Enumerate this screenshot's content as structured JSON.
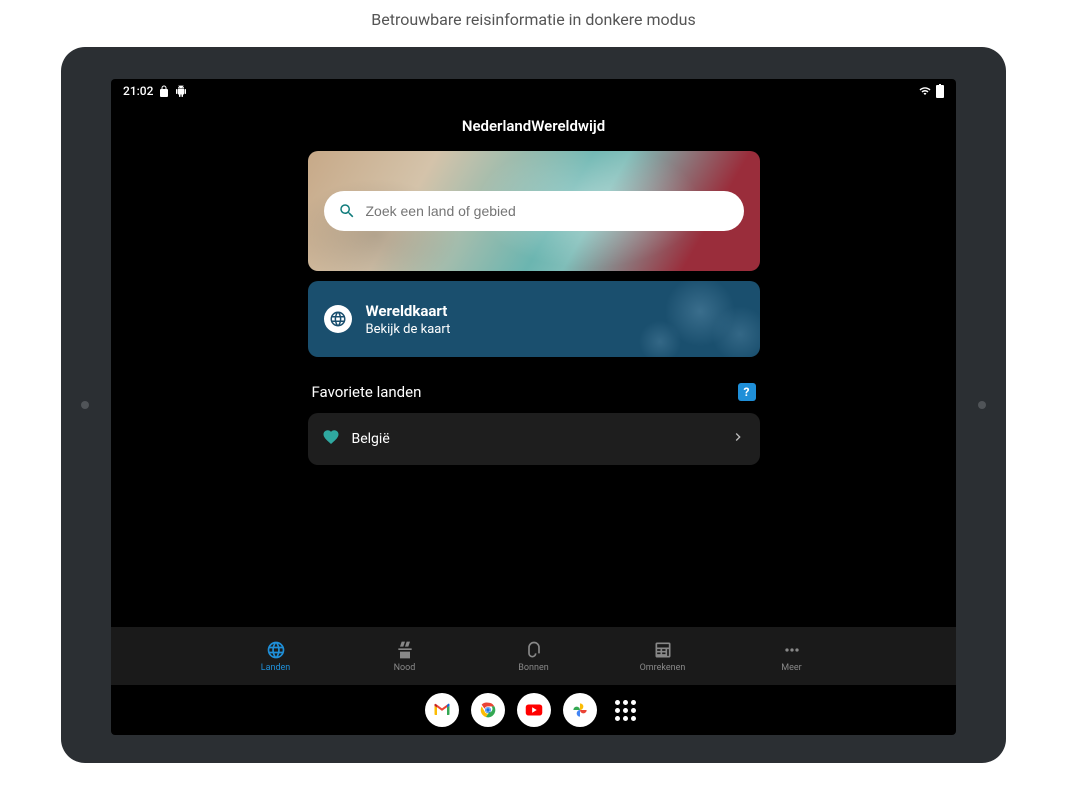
{
  "caption": "Betrouwbare reisinformatie in donkere modus",
  "statusbar": {
    "time": "21:02"
  },
  "header": {
    "title": "NederlandWereldwijd"
  },
  "search": {
    "placeholder": "Zoek een land of gebied"
  },
  "mapcard": {
    "title": "Wereldkaart",
    "subtitle": "Bekijk de kaart"
  },
  "favorites": {
    "heading": "Favoriete landen",
    "help_symbol": "?",
    "items": [
      "België"
    ]
  },
  "nav": {
    "items": [
      {
        "label": "Landen",
        "active": true
      },
      {
        "label": "Nood",
        "active": false
      },
      {
        "label": "Bonnen",
        "active": false
      },
      {
        "label": "Omrekenen",
        "active": false
      },
      {
        "label": "Meer",
        "active": false
      }
    ]
  }
}
